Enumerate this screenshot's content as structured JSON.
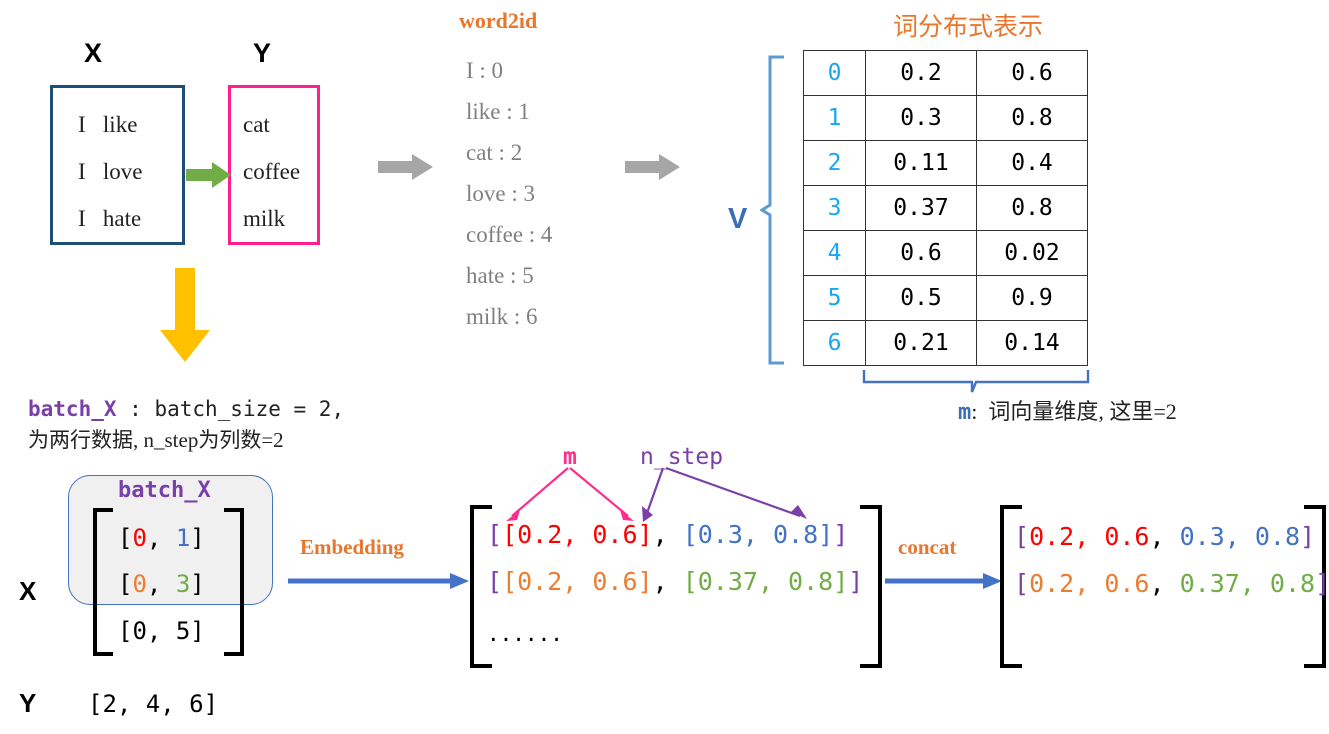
{
  "top": {
    "x_label": "X",
    "y_label": "Y",
    "x_rows": [
      "I   like",
      "I   love",
      "I   hate"
    ],
    "y_rows": [
      "cat",
      "coffee",
      "milk"
    ],
    "x_box_color": "#1F4E79",
    "y_box_color": "#FF1F8F",
    "green_arrow_color": "#70AD47",
    "yellow_arrow_color": "#FFC000",
    "gray_arrow_color": "#A6A6A6"
  },
  "word2id": {
    "title": "word2id",
    "title_color": "#E8762C",
    "entries": [
      "I : 0",
      "like : 1",
      "cat : 2",
      "love : 3",
      "coffee : 4",
      "hate : 5",
      "milk : 6"
    ]
  },
  "distributed": {
    "title": "词分布式表示",
    "title_color": "#E8762C",
    "v_label": "V",
    "v_label_color": "#3A6FB5",
    "index_color": "#18A7F0",
    "rows": [
      {
        "id": "0",
        "v1": "0.2",
        "v2": "0.6"
      },
      {
        "id": "1",
        "v1": "0.3",
        "v2": "0.8"
      },
      {
        "id": "2",
        "v1": "0.11",
        "v2": "0.4"
      },
      {
        "id": "3",
        "v1": "0.37",
        "v2": "0.8"
      },
      {
        "id": "4",
        "v1": "0.6",
        "v2": "0.02"
      },
      {
        "id": "5",
        "v1": "0.5",
        "v2": "0.9"
      },
      {
        "id": "6",
        "v1": "0.21",
        "v2": "0.14"
      }
    ],
    "m_symbol": "m",
    "m_caption": ":  词向量维度, 这里=2"
  },
  "batch_caption": {
    "keyword": "batch_X",
    "line1_rest": " : batch_size = 2,",
    "line2": "为两行数据, n_step为列数=2"
  },
  "batch_panel": {
    "title": "batch_X",
    "title_color": "#7A3FA8",
    "x_label": "X",
    "y_label": "Y",
    "rows": [
      {
        "open": "[",
        "a": "0",
        "sep": ", ",
        "b": "1",
        "close": "]",
        "a_color": "#FF0000",
        "b_color": "#4472C4"
      },
      {
        "open": "[",
        "a": "0",
        "sep": ", ",
        "b": "3",
        "close": "]",
        "a_color": "#ED7D31",
        "b_color": "#70AD47"
      },
      {
        "open": "[",
        "a": "0",
        "sep": ", ",
        "b": "5",
        "close": "]",
        "a_color": "#000000",
        "b_color": "#000000"
      }
    ],
    "y_vector": "[2, 4, 6]"
  },
  "embedding": {
    "label": "Embedding",
    "label_color": "#E8762C",
    "arrow_color": "#4472C4"
  },
  "middle_matrix": {
    "m_label": "m",
    "m_color": "#FF2D8E",
    "nstep_label": "n_step",
    "nstep_color": "#7A3FA8",
    "row0": {
      "b1": "[",
      "seg1": "[0.2, 0.6]",
      "comma": ", ",
      "seg2": "[0.3, 0.8]",
      "b2": "]",
      "seg1_color": "#FF0000",
      "seg2_color": "#4472C4",
      "bracket_color": "#7A3FA8"
    },
    "row1": {
      "b1": "[",
      "seg1": "[0.2, 0.6]",
      "comma": ", ",
      "seg2": "[0.37, 0.8]",
      "b2": "]",
      "seg1_color": "#ED7D31",
      "seg2_color": "#70AD47",
      "bracket_color": "#7A3FA8"
    },
    "ellipsis": "......"
  },
  "concat": {
    "label": "concat",
    "label_color": "#E8762C",
    "arrow_color": "#4472C4",
    "row0": {
      "open": "[",
      "seg1": "0.2, 0.6",
      "comma": ", ",
      "seg2": "0.3, 0.8",
      "close": "]",
      "seg1_color": "#FF0000",
      "seg2_color": "#4472C4",
      "bracket_color": "#7A3FA8"
    },
    "row1": {
      "open": "[",
      "seg1": "0.2, 0.6",
      "comma": ", ",
      "seg2": "0.37, 0.8",
      "close": "]",
      "seg1_color": "#ED7D31",
      "seg2_color": "#70AD47",
      "bracket_color": "#7A3FA8"
    }
  }
}
